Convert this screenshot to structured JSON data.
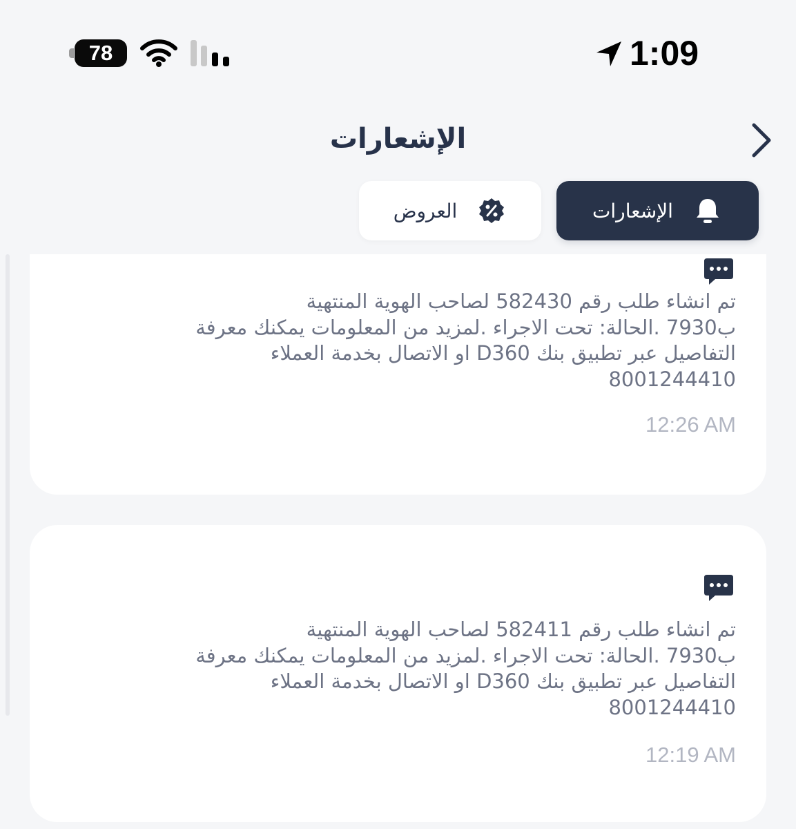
{
  "status_bar": {
    "time": "1:09",
    "battery": "78",
    "icons": [
      "location-arrow-icon",
      "wifi-icon",
      "cellular-signal-icon",
      "battery-icon"
    ]
  },
  "header": {
    "title": "الإشعارات",
    "back_icon": "chevron-right-icon"
  },
  "tabs": [
    {
      "label": "الإشعارات",
      "icon": "bell-icon",
      "active": true
    },
    {
      "label": "العروض",
      "icon": "discount-badge-icon",
      "active": false
    }
  ],
  "colors": {
    "background": "#f5f6f8",
    "primary_dark": "#283349",
    "card_background": "#ffffff",
    "body_text": "#6d7385",
    "timestamp_text": "#b2b6c2"
  },
  "notifications": [
    {
      "icon": "message-bubble-icon",
      "lines": [
        "تم انشاء طلب رقم 582430 لصاحب الهوية المنتهية",
        "ب7930 .الحالة: تحت الاجراء .لمزيد من المعلومات يمكنك معرفة",
        "التفاصيل عبر تطبيق بنك D360 او الاتصال بخدمة العملاء",
        "8001244410"
      ],
      "time": "12:26 AM"
    },
    {
      "icon": "message-bubble-icon",
      "lines": [
        "تم انشاء طلب رقم 582411 لصاحب الهوية المنتهية",
        "ب7930 .الحالة: تحت الاجراء .لمزيد من المعلومات يمكنك معرفة",
        "التفاصيل عبر تطبيق بنك D360 او الاتصال بخدمة العملاء",
        "8001244410"
      ],
      "time": "12:19 AM"
    }
  ]
}
